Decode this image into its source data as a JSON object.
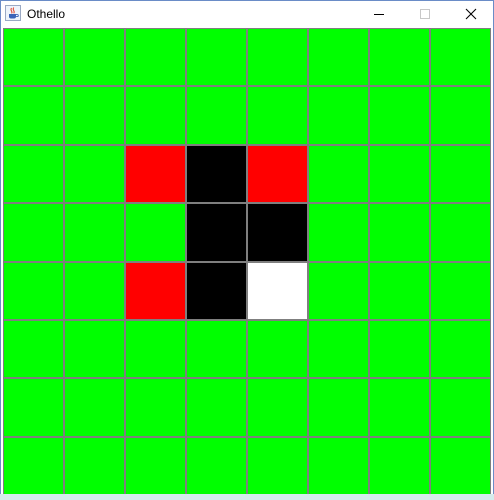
{
  "window": {
    "title": "Othello",
    "app_icon": "java-coffee-cup-icon",
    "controls": {
      "minimize": "minimize-icon",
      "maximize": "maximize-icon",
      "close": "close-icon"
    }
  },
  "board": {
    "rows": 8,
    "cols": 8,
    "colors": {
      "empty": "#00ff00",
      "black": "#000000",
      "white": "#ffffff",
      "hint": "#ff0000",
      "grid": "#7f7f7f"
    },
    "cells": [
      [
        "empty",
        "empty",
        "empty",
        "empty",
        "empty",
        "empty",
        "empty",
        "empty"
      ],
      [
        "empty",
        "empty",
        "empty",
        "empty",
        "empty",
        "empty",
        "empty",
        "empty"
      ],
      [
        "empty",
        "empty",
        "hint",
        "black",
        "hint",
        "empty",
        "empty",
        "empty"
      ],
      [
        "empty",
        "empty",
        "empty",
        "black",
        "black",
        "empty",
        "empty",
        "empty"
      ],
      [
        "empty",
        "empty",
        "hint",
        "black",
        "white",
        "empty",
        "empty",
        "empty"
      ],
      [
        "empty",
        "empty",
        "empty",
        "empty",
        "empty",
        "empty",
        "empty",
        "empty"
      ],
      [
        "empty",
        "empty",
        "empty",
        "empty",
        "empty",
        "empty",
        "empty",
        "empty"
      ],
      [
        "empty",
        "empty",
        "empty",
        "empty",
        "empty",
        "empty",
        "empty",
        "empty"
      ]
    ]
  }
}
